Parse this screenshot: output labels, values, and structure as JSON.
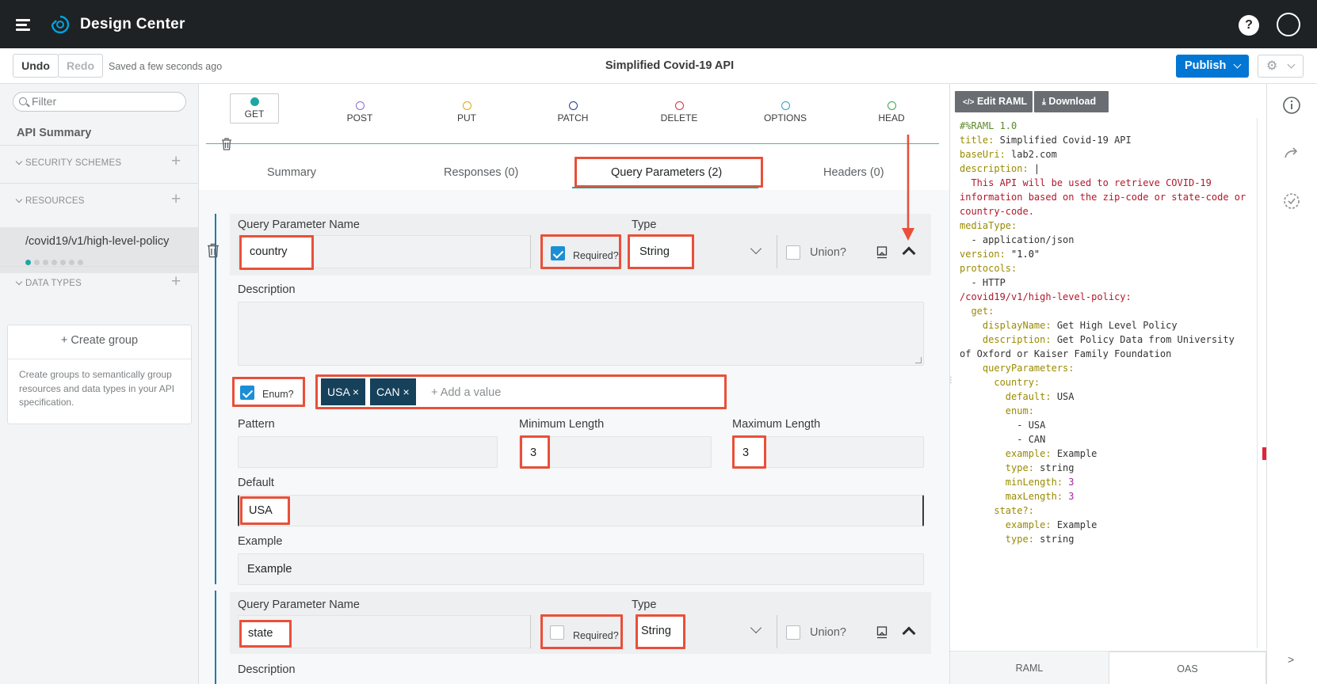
{
  "app": {
    "title": "Design Center"
  },
  "topbar": {
    "help_label": "?"
  },
  "toolbar": {
    "undo": "Undo",
    "redo": "Redo",
    "saved_status": "Saved a few seconds ago",
    "api_title": "Simplified Covid-19 API",
    "publish": "Publish"
  },
  "sidebar": {
    "filter_placeholder": "Filter",
    "api_summary": "API Summary",
    "security_schemes": "SECURITY SCHEMES",
    "resources": "RESOURCES",
    "resource_path": "/covid19/v1/high-level-policy",
    "data_types": "DATA TYPES",
    "create_group": "+ Create group",
    "group_help": "Create groups to semantically group resources and data types in your API specification."
  },
  "methods": [
    {
      "label": "GET",
      "color": "#1ea7a0",
      "selected": true
    },
    {
      "label": "POST",
      "color": "#8d6bd6"
    },
    {
      "label": "PUT",
      "color": "#e8a60b"
    },
    {
      "label": "PATCH",
      "color": "#2d3a8c"
    },
    {
      "label": "DELETE",
      "color": "#d6303a"
    },
    {
      "label": "OPTIONS",
      "color": "#2aa3c0"
    },
    {
      "label": "HEAD",
      "color": "#3aa845"
    }
  ],
  "tabs": {
    "summary": "Summary",
    "responses": "Responses (0)",
    "query_parameters": "Query Parameters (2)",
    "headers": "Headers (0)"
  },
  "params": [
    {
      "name_label": "Query Parameter Name",
      "name": "country",
      "required_label": "Required?",
      "required": true,
      "type_label": "Type",
      "type": "String",
      "union_label": "Union?",
      "description_label": "Description",
      "enum_label": "Enum?",
      "enum_values": [
        "USA",
        "CAN"
      ],
      "add_value_placeholder": "+ Add a value",
      "pattern_label": "Pattern",
      "min_length_label": "Minimum Length",
      "min_length": "3",
      "max_length_label": "Maximum Length",
      "max_length": "3",
      "default_label": "Default",
      "default": "USA",
      "example_label": "Example",
      "example": "Example"
    },
    {
      "name_label": "Query Parameter Name",
      "name": "state",
      "required_label": "Required?",
      "required": false,
      "type_label": "Type",
      "type": "String",
      "union_label": "Union?",
      "description_label": "Description"
    }
  ],
  "raml_panel": {
    "edit_raml": "Edit RAML",
    "download": "Download",
    "code_lines": [
      "#%RAML 1.0",
      "title: Simplified Covid-19 API",
      "baseUri: lab2.com",
      "description: |",
      "  This API will be used to retrieve COVID-19",
      "information based on the zip-code or state-code or",
      "country-code.",
      "mediaType:",
      "  - application/json",
      "version: \"1.0\"",
      "protocols:",
      "  - HTTP",
      "/covid19/v1/high-level-policy:",
      "  get:",
      "    displayName: Get High Level Policy",
      "    description: Get Policy Data from University",
      "of Oxford or Kaiser Family Foundation",
      "    queryParameters:",
      "      country:",
      "        default: USA",
      "        enum:",
      "          - USA",
      "          - CAN",
      "        example: Example",
      "        type: string",
      "        minLength: 3",
      "        maxLength: 3",
      "      state?:",
      "        example: Example",
      "        type: string"
    ],
    "tab_raml": "RAML",
    "tab_oas": "OAS"
  },
  "rail": {
    "collapse": ">"
  },
  "colors": {
    "accent": "#0176d3",
    "highlight": "#e8503a",
    "topbar": "#1f2224",
    "tag": "#16415b"
  }
}
